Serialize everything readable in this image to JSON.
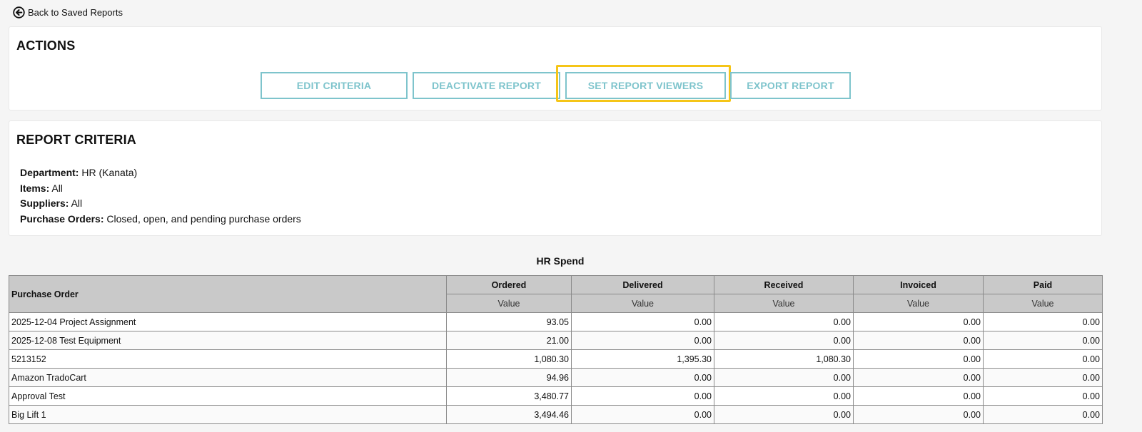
{
  "nav": {
    "back_label": "Back to Saved Reports"
  },
  "actions": {
    "title": "ACTIONS",
    "buttons": {
      "edit": "EDIT CRITERIA",
      "deactivate": "DEACTIVATE REPORT",
      "set_viewers": "SET REPORT VIEWERS",
      "export": "EXPORT REPORT"
    }
  },
  "criteria": {
    "title": "REPORT CRITERIA",
    "items": [
      {
        "label": "Department:",
        "value": "HR (Kanata)"
      },
      {
        "label": "Items:",
        "value": "All"
      },
      {
        "label": "Suppliers:",
        "value": "All"
      },
      {
        "label": "Purchase Orders:",
        "value": "Closed, open, and pending purchase orders"
      }
    ]
  },
  "report": {
    "title": "HR Spend",
    "headers": {
      "po": "Purchase Order",
      "cols": [
        "Ordered",
        "Delivered",
        "Received",
        "Invoiced",
        "Paid"
      ],
      "sub": "Value"
    },
    "rows": [
      {
        "po": "2025-12-04 Project Assignment",
        "values": [
          "93.05",
          "0.00",
          "0.00",
          "0.00",
          "0.00"
        ]
      },
      {
        "po": "2025-12-08 Test Equipment",
        "values": [
          "21.00",
          "0.00",
          "0.00",
          "0.00",
          "0.00"
        ]
      },
      {
        "po": "5213152",
        "values": [
          "1,080.30",
          "1,395.30",
          "1,080.30",
          "0.00",
          "0.00"
        ]
      },
      {
        "po": "Amazon TradoCart",
        "values": [
          "94.96",
          "0.00",
          "0.00",
          "0.00",
          "0.00"
        ]
      },
      {
        "po": "Approval Test",
        "values": [
          "3,480.77",
          "0.00",
          "0.00",
          "0.00",
          "0.00"
        ]
      },
      {
        "po": "Big Lift 1",
        "values": [
          "3,494.46",
          "0.00",
          "0.00",
          "0.00",
          "0.00"
        ]
      }
    ]
  },
  "colors": {
    "button_accent": "#7ec4cc",
    "highlight": "#f5c518",
    "header_bg": "#c9c9c9"
  }
}
